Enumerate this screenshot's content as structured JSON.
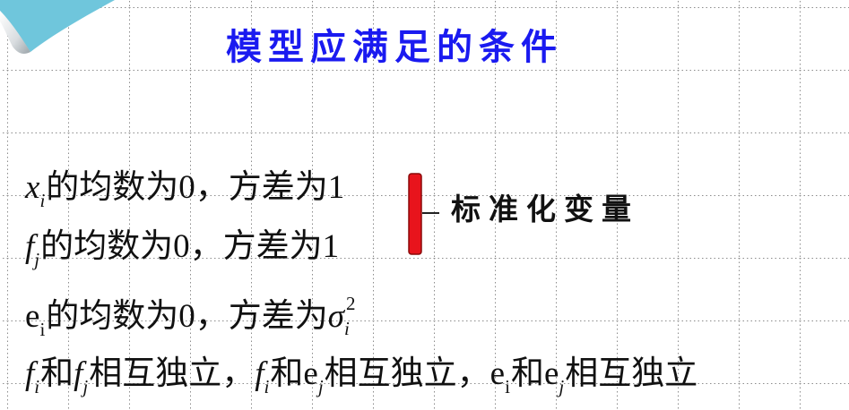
{
  "title": "模型应满足的条件",
  "conditions": {
    "line1": {
      "var": "x",
      "sub": "i",
      "rest": "的均数为0，方差为1"
    },
    "line2": {
      "var": "f",
      "sub": "j",
      "rest": "的均数为0，方差为1"
    },
    "line3": {
      "var": "e",
      "sub": "i",
      "rest": "的均数为0，方差为",
      "sigma": "σ",
      "sigma_sub": "i",
      "sigma_sup": "2"
    },
    "line4": [
      "f",
      "i",
      "和",
      "f",
      "j",
      "相互独立，",
      "f",
      "i",
      "和",
      "e",
      "j",
      "相互独立，",
      "e",
      "i",
      "和",
      "e",
      "j",
      "相互独立"
    ]
  },
  "bracket_label": "标准化变量",
  "colors": {
    "title": "#1a1af0",
    "bracket_fill": "#e8141c",
    "bracket_stroke": "#8a0a0a",
    "corner_blue": "#6fc6dc",
    "grid": "#8c8c8c"
  }
}
